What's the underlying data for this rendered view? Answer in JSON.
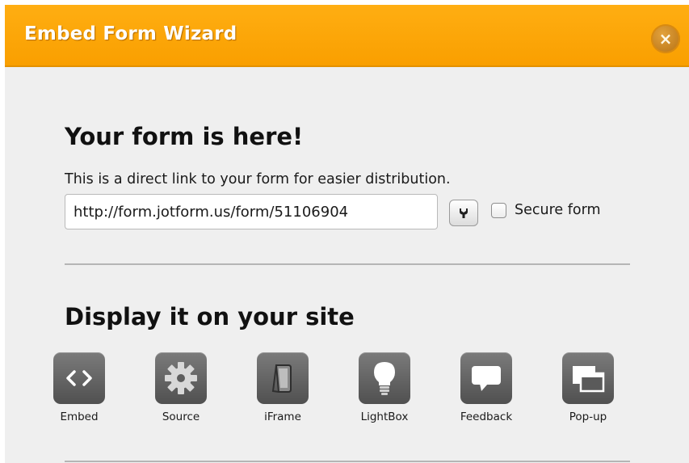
{
  "dialog": {
    "title": "Embed Form Wizard",
    "close_label": "×"
  },
  "link_section": {
    "heading": "Your form is here!",
    "description": "This is a direct link to your form for easier distribution.",
    "url_value": "http://form.jotform.us/form/51106904",
    "secure_label": "Secure form",
    "secure_checked": false
  },
  "display_section": {
    "heading": "Display it on your site",
    "options": [
      {
        "label": "Embed",
        "icon": "code-brackets-icon"
      },
      {
        "label": "Source",
        "icon": "gear-icon"
      },
      {
        "label": "iFrame",
        "icon": "picture-frame-icon"
      },
      {
        "label": "LightBox",
        "icon": "lightbulb-icon"
      },
      {
        "label": "Feedback",
        "icon": "speech-bubble-icon"
      },
      {
        "label": "Pop-up",
        "icon": "popup-windows-icon"
      }
    ]
  },
  "colors": {
    "titlebar": "#f99f00",
    "panel": "#efefef",
    "tile": "#5f5f5f"
  }
}
